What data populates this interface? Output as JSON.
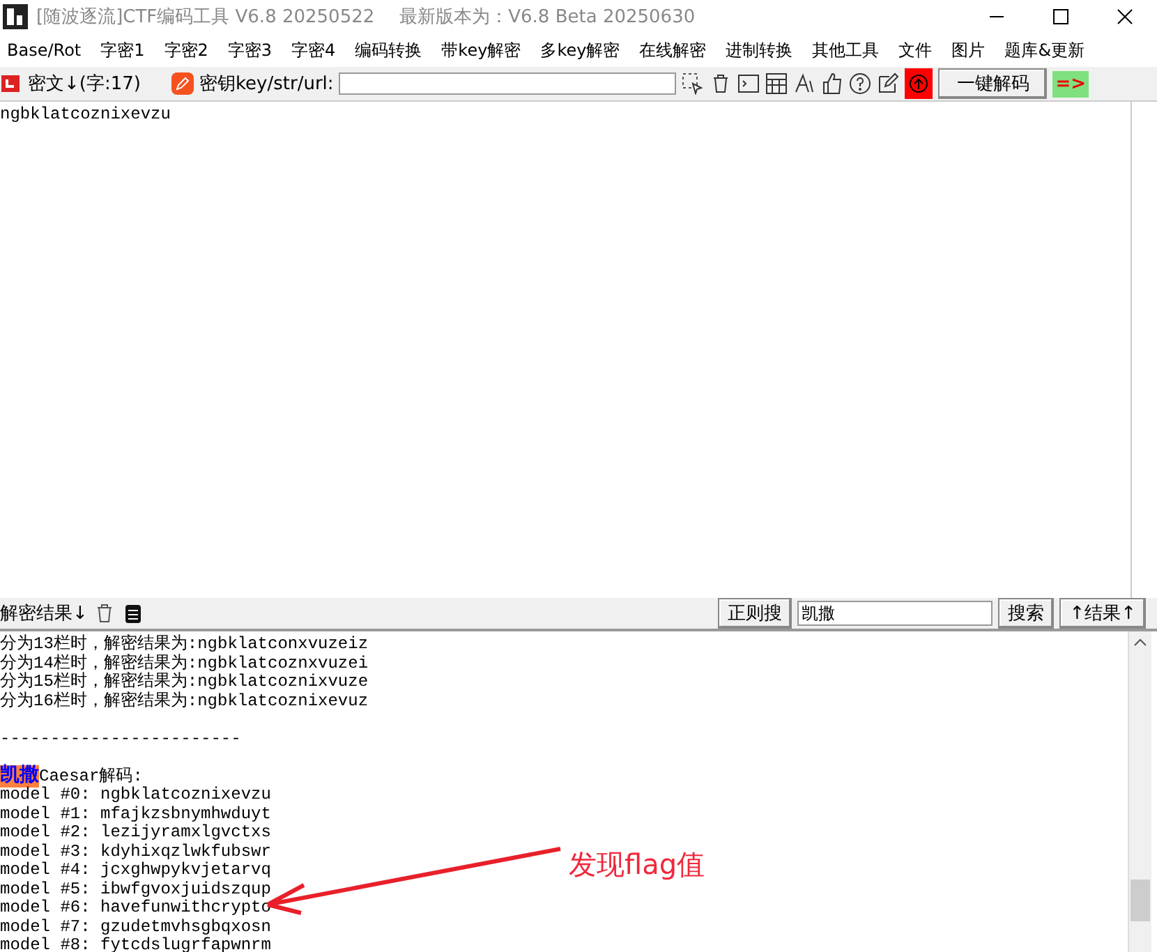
{
  "window": {
    "title": "[随波逐流]CTF编码工具 V6.8 20250522",
    "update_notice": "最新版本为：V6.8 Beta 20250630"
  },
  "menu": [
    "Base/Rot",
    "字密1",
    "字密2",
    "字密3",
    "字密4",
    "编码转换",
    "带key解密",
    "多key解密",
    "在线解密",
    "进制转换",
    "其他工具",
    "文件",
    "图片",
    "题库&更新"
  ],
  "input_bar": {
    "label": "密文↓(字:17)",
    "key_label": "密钥key/str/url:",
    "decode_button": "一键解码",
    "arrow_label": "=>"
  },
  "input_text": "ngbklatcoznixevzu",
  "output_bar": {
    "label": "解密结果↓",
    "regex_button": "正则搜",
    "search_value": "凯撒",
    "search_button": "搜索",
    "result_button": "↑结果↑"
  },
  "output_lines": [
    {
      "kind": "text",
      "text": "分为13栏时，解密结果为:ngbklatconxvuzeiz"
    },
    {
      "kind": "text",
      "text": "分为14栏时，解密结果为:ngbklatcoznxvuzei"
    },
    {
      "kind": "text",
      "text": "分为15栏时，解密结果为:ngbklatcoznixvuze"
    },
    {
      "kind": "text",
      "text": "分为16栏时，解密结果为:ngbklatcoznixevuz"
    },
    {
      "kind": "blank"
    },
    {
      "kind": "text",
      "text": "------------------------"
    },
    {
      "kind": "blank"
    },
    {
      "kind": "heading",
      "highlight": "凯撒",
      "text": "Caesar解码:"
    },
    {
      "kind": "text",
      "text": "model #0: ngbklatcoznixevzu"
    },
    {
      "kind": "text",
      "text": "model #1: mfajkzsbnymhwduyt"
    },
    {
      "kind": "text",
      "text": "model #2: lezijyramxlgvctxs"
    },
    {
      "kind": "text",
      "text": "model #3: kdyhixqzlwkfubswr"
    },
    {
      "kind": "text",
      "text": "model #4: jcxghwpykvjetarvq"
    },
    {
      "kind": "text",
      "text": "model #5: ibwfgvoxjuidszqup"
    },
    {
      "kind": "text",
      "text": "model #6: havefunwithcrypto"
    },
    {
      "kind": "text",
      "text": "model #7: gzudetmvhsgbqxosn"
    },
    {
      "kind": "text",
      "text": "model #8: fytcdslugrfapwnrm"
    }
  ],
  "annotation": {
    "text": "发现flag值"
  }
}
